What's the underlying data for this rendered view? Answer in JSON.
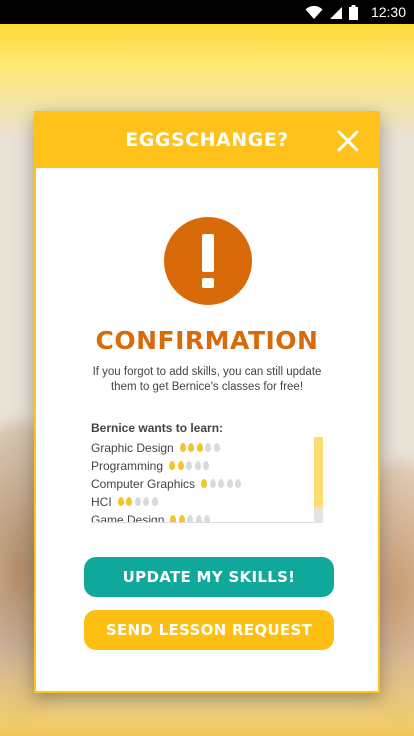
{
  "status_bar": {
    "time": "12:30",
    "icons": [
      "wifi-icon",
      "signal-icon",
      "battery-icon"
    ]
  },
  "dialog": {
    "title": "EGGSCHANGE?",
    "close_icon": "close-icon",
    "alert_icon": "exclamation-icon",
    "heading": "CONFIRMATION",
    "message": "If you forgot to add skills, you can still update them to get Bernice's classes for free!",
    "skills_title": "Bernice wants to learn:",
    "skills": [
      {
        "name": "Graphic Design",
        "level": 3,
        "max": 5
      },
      {
        "name": "Programming",
        "level": 2,
        "max": 5
      },
      {
        "name": "Computer Graphics",
        "level": 1,
        "max": 5
      },
      {
        "name": "HCI",
        "level": 2,
        "max": 5
      },
      {
        "name": "Game Design",
        "level": 2,
        "max": 5
      }
    ],
    "primary_button": "UPDATE MY SKILLS!",
    "secondary_button": "SEND LESSON REQUEST"
  },
  "colors": {
    "header": "#ffc21a",
    "accent_orange": "#d86a0a",
    "teal": "#0fa89a",
    "yellow_button": "#ffbf12",
    "egg_filled": "#f4c42b",
    "egg_empty": "#dadada"
  }
}
